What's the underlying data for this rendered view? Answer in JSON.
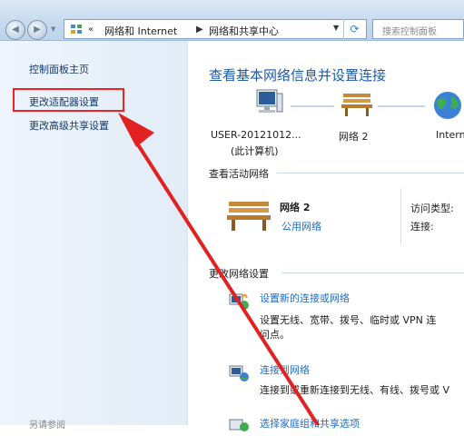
{
  "address_bar": {
    "nav_chevron": "«",
    "crumbs": [
      "网络和 Internet",
      "网络和共享中心"
    ],
    "search_placeholder": "搜索控制面板"
  },
  "left_pane": {
    "links": [
      "控制面板主页",
      "更改适配器设置",
      "更改高级共享设置"
    ],
    "see_also": "另请参阅"
  },
  "main": {
    "title": "查看基本网络信息并设置连接",
    "map": {
      "computer_name": "USER-20121012...",
      "computer_sub": "(此计算机)",
      "network_label": "网络  2",
      "internet_label": "Intern"
    },
    "active_networks_heading": "查看活动网络",
    "active_network": {
      "name": "网络  2",
      "type": "公用网络",
      "access_type_label": "访问类型:",
      "connection_label": "连接:"
    },
    "change_settings_heading": "更改网络设置",
    "tasks": [
      {
        "title": "设置新的连接或网络",
        "desc": [
          "设置无线、宽带、拨号、临时或 VPN 连",
          "问点。"
        ]
      },
      {
        "title": "连接到网络",
        "desc": [
          "连接到或重新连接到无线、有线、拨号或 V"
        ]
      },
      {
        "title": "选择家庭组和共享选项",
        "desc": []
      }
    ]
  },
  "colors": {
    "link": "#1e6bc8",
    "title": "#1e5aa8",
    "annotation": "#e22222"
  }
}
